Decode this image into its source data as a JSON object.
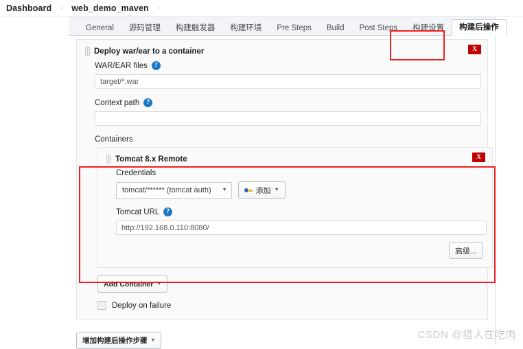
{
  "breadcrumb": {
    "items": [
      {
        "label": "Dashboard"
      },
      {
        "label": "web_demo_maven"
      }
    ],
    "separator": "›"
  },
  "tabs": [
    {
      "label": "General",
      "active": false
    },
    {
      "label": "源码管理",
      "active": false
    },
    {
      "label": "构建触发器",
      "active": false
    },
    {
      "label": "构建环境",
      "active": false
    },
    {
      "label": "Pre Steps",
      "active": false
    },
    {
      "label": "Build",
      "active": false
    },
    {
      "label": "Post Steps",
      "active": false
    },
    {
      "label": "构建设置",
      "active": false
    },
    {
      "label": "构建后操作",
      "active": true
    }
  ],
  "post_build": {
    "title": "Deploy war/ear to a container",
    "close_label": "X",
    "war_ear": {
      "label": "WAR/EAR files",
      "help": "?",
      "value": "target/*.war",
      "placeholder": "target/*.war"
    },
    "context_path": {
      "label": "Context path",
      "help": "?",
      "value": "",
      "placeholder": ""
    },
    "containers_label": "Containers",
    "container": {
      "title": "Tomcat 8.x Remote",
      "close_label": "X",
      "credentials_label": "Credentials",
      "credentials_value": "tomcat/****** (tomcat  auth)",
      "add_credentials_label": "添加",
      "tomcat_url": {
        "label": "Tomcat URL",
        "help": "?",
        "value": "http://192.168.0.110:8080/",
        "placeholder": "http://192.168.0.110:8080/"
      },
      "advanced_label": "高级..."
    },
    "add_container_label": "Add Container",
    "deploy_on_failure_label": "Deploy on failure",
    "deploy_on_failure_checked": false
  },
  "add_post_build_step_label": "增加构建后操作步骤",
  "watermark": "CSDN @猎人在吃肉",
  "colors": {
    "highlight": "#f02020",
    "close_button": "#c00000",
    "help_icon": "#1b79c4",
    "tabbar_bg": "#f2f4f7",
    "panel_bg": "#fafafa"
  },
  "icons": {
    "caret_down": "▼",
    "grip": "grip-dots"
  }
}
